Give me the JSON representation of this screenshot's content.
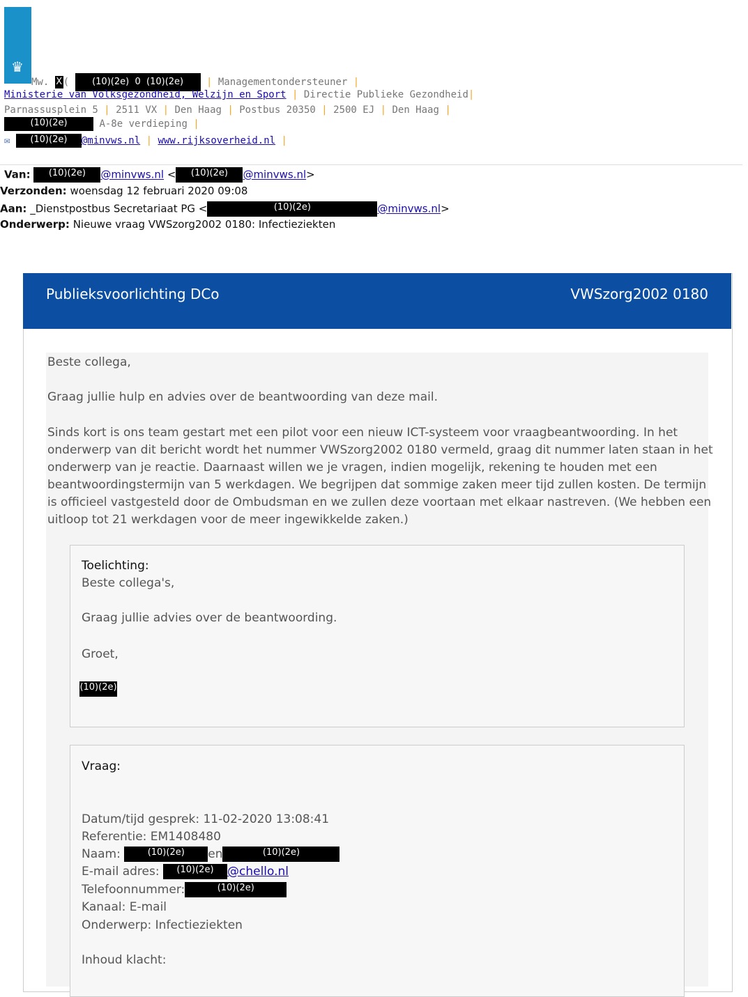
{
  "signature": {
    "name_prefix": "Mw.",
    "name_initial_redacted": "X",
    "name_paren": "(",
    "redact_1": "(10)(2e)",
    "redact_mid": "0",
    "redact_2": "(10)(2e)",
    "role": "Managementondersteuner",
    "ministry_link": "Ministerie van Volksgezondheid, Welzijn en Sport",
    "directorate": "Directie Publieke Gezondheid",
    "address": [
      "Parnassusplein 5",
      "2511 VX",
      "Den Haag",
      "Postbus 20350",
      "2500 EJ",
      "Den Haag"
    ],
    "redact_room": "(10)(2e)",
    "floor": "A-8e verdieping",
    "redact_email": "(10)(2e)",
    "email_domain": "@minvws.nl",
    "website": "www.rijksoverheid.nl",
    "mail_icon": "envelope-icon"
  },
  "header": {
    "from_label": "Van:",
    "from_redact": "(10)(2e)",
    "from_domain": "@minvws.nl",
    "from_lt": "<",
    "from_redact2": "(10)(2e)",
    "from_domain2": "@minvws.nl",
    "from_gt": ">",
    "sent_label": "Verzonden:",
    "sent_value": "woensdag 12 februari 2020 09:08",
    "to_label": "Aan:",
    "to_value": "_Dienstpostbus Secretariaat PG <",
    "to_redact": "(10)(2e)",
    "to_domain": "@minvws.nl",
    "to_gt": ">",
    "subject_label": "Onderwerp:",
    "subject_value": "Nieuwe vraag VWSzorg2002 0180: Infectieziekten"
  },
  "banner": {
    "left": "Publieksvoorlichting DCo",
    "right": "VWSzorg2002 0180"
  },
  "body": {
    "greeting": "Beste collega,",
    "line1": "Graag jullie hulp en advies over de beantwoording van deze mail.",
    "para_lines": [
      "Sinds kort is ons team gestart met een pilot voor een nieuw ICT-systeem voor vraagbeantwoording. In het",
      "onderwerp van dit bericht wordt het nummer VWSzorg2002 0180 vermeld, graag dit nummer laten staan in het",
      "onderwerp van je reactie. Daarnaast willen we je vragen, indien mogelijk, rekening te houden met een",
      "beantwoordingstermijn van 5 werkdagen. We begrijpen dat sommige zaken meer tijd zullen kosten. De termijn",
      "is officieel vastgesteld door de Ombudsman en we zullen deze voortaan met elkaar nastreven. (We hebben een",
      "uitloop tot 21 werkdagen voor de meer ingewikkelde zaken.)"
    ]
  },
  "toelichting": {
    "heading": "Toelichting:",
    "l1": "Beste collega's,",
    "l2": "Graag jullie advies over de beantwoording.",
    "l3": "Groet,",
    "redact": "(10)(2e)"
  },
  "vraag": {
    "heading": "Vraag:",
    "datum": "Datum/tijd gesprek: 11-02-2020 13:08:41",
    "referentie": "Referentie: EM1408480",
    "naam_label": "Naam:",
    "naam_redact1": "(10)(2e)",
    "naam_en": "en",
    "naam_redact2": "(10)(2e)",
    "email_label": "E-mail adres:",
    "email_redact": "(10)(2e)",
    "email_domain": "@chello.nl",
    "tel_label": "Telefoonnummer:",
    "tel_redact": "(10)(2e)",
    "kanaal": "Kanaal: E-mail",
    "onderwerp": "Onderwerp: Infectieziekten",
    "inhoud": "Inhoud klacht:"
  }
}
